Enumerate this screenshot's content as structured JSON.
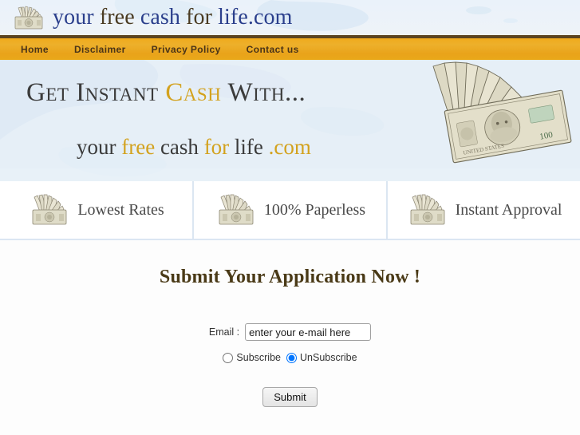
{
  "header": {
    "logo_icon": "money-fan-icon",
    "logo_parts": [
      {
        "text": "your ",
        "color": "blue"
      },
      {
        "text": "free ",
        "color": "brown"
      },
      {
        "text": "cash ",
        "color": "blue"
      },
      {
        "text": "for ",
        "color": "brown"
      },
      {
        "text": "life.com",
        "color": "blue"
      }
    ],
    "logo_full_text": "your free cash for life.com"
  },
  "nav": {
    "items": [
      {
        "label": "Home"
      },
      {
        "label": "Disclaimer"
      },
      {
        "label": "Privacy Policy"
      },
      {
        "label": "Contact us"
      }
    ]
  },
  "hero": {
    "line1": [
      {
        "text": "Get Instant ",
        "color": "dark"
      },
      {
        "text": "Cash ",
        "color": "gold"
      },
      {
        "text": "With...",
        "color": "dark"
      }
    ],
    "line1_full": "Get Instant Cash With...",
    "line2": [
      {
        "text": "your ",
        "color": "dark"
      },
      {
        "text": "free ",
        "color": "gold"
      },
      {
        "text": "cash ",
        "color": "dark"
      },
      {
        "text": "for ",
        "color": "gold"
      },
      {
        "text": "life ",
        "color": "dark"
      },
      {
        "text": ".com",
        "color": "gold"
      }
    ],
    "line2_full": "your free cash for life .com",
    "image": "money-fan-hundred-dollar-bills"
  },
  "features": [
    {
      "icon": "money-fan-icon",
      "label": "Lowest Rates"
    },
    {
      "icon": "money-fan-icon",
      "label": "100% Paperless"
    },
    {
      "icon": "money-fan-icon",
      "label": "Instant Approval"
    }
  ],
  "form": {
    "title": "Submit Your Application Now !",
    "email_label": "Email :",
    "email_value": "enter your e-mail here",
    "email_placeholder": "enter your e-mail here",
    "subscribe_label": "Subscribe",
    "unsubscribe_label": "UnSubscribe",
    "selected_option": "UnSubscribe",
    "submit_label": "Submit"
  },
  "colors": {
    "nav_gold": "#eda61c",
    "nav_border_brown": "#5b4420",
    "logo_blue": "#2b3f8c",
    "logo_brown": "#4a3b22",
    "hero_gold": "#d3a21e",
    "hero_dark": "#3b3b3b",
    "title_brown": "#4a3a17",
    "hero_bg_blue": "#e4eef7",
    "divider_blue": "#dbe6f2"
  }
}
